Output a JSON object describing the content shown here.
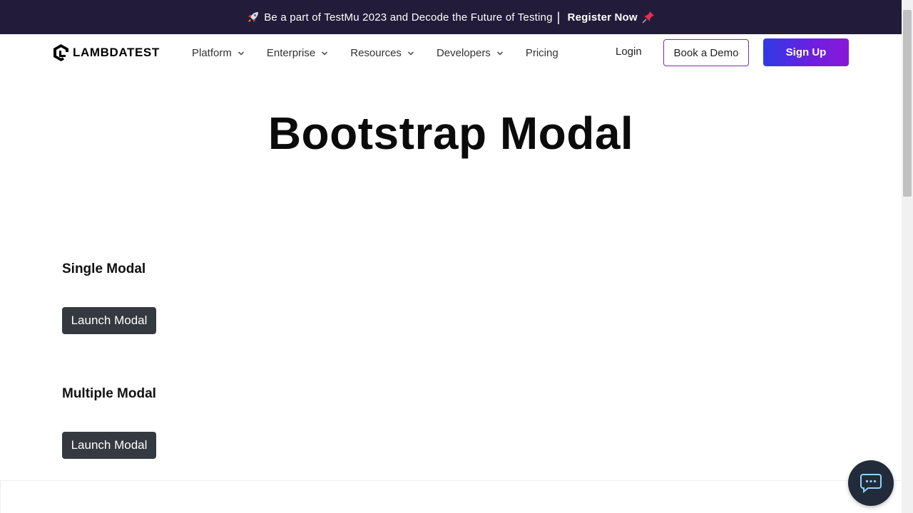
{
  "announcement": {
    "text": "Be a part of TestMu 2023 and Decode the Future of Testing",
    "separator": "|",
    "cta": "Register Now",
    "icons": [
      "rocket-icon",
      "pushpin-icon"
    ]
  },
  "navbar": {
    "logo_text": "LAMBDATEST",
    "menu": [
      {
        "label": "Platform",
        "has_dropdown": true
      },
      {
        "label": "Enterprise",
        "has_dropdown": true
      },
      {
        "label": "Resources",
        "has_dropdown": true
      },
      {
        "label": "Developers",
        "has_dropdown": true
      },
      {
        "label": "Pricing",
        "has_dropdown": false
      }
    ],
    "login": "Login",
    "book_demo": "Book a Demo",
    "sign_up": "Sign Up"
  },
  "main": {
    "title": "Bootstrap Modal",
    "sections": [
      {
        "title": "Single Modal",
        "button": "Launch Modal"
      },
      {
        "title": "Multiple Modal",
        "button": "Launch Modal"
      }
    ]
  },
  "chat": {
    "icon": "chat-icon"
  },
  "colors": {
    "announce_bg": "#221c3a",
    "button_dark": "#343a40",
    "signup_gradient_start": "#2f3ae6",
    "signup_gradient_end": "#8a18d8",
    "chat_bg": "#222b3a"
  }
}
